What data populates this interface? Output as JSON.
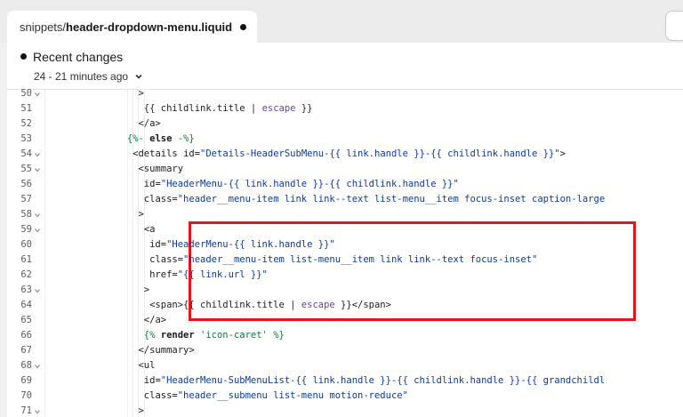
{
  "tab": {
    "directory": "snippets/",
    "filename": "header-dropdown-menu.liquid",
    "unsaved_indicator_icon": "dot-icon"
  },
  "changes": {
    "title": "Recent changes",
    "range": "24 - 21 minutes ago",
    "dropdown_icon": "chevron-down-icon"
  },
  "code_lines": [
    {
      "n": "50",
      "fold": true,
      "indent": 14,
      "html": ">"
    },
    {
      "n": "51",
      "fold": false,
      "indent": 15,
      "html": "{{ childlink.title | <span class='t-flt'>escape</span> }}"
    },
    {
      "n": "52",
      "fold": false,
      "indent": 14,
      "html": "&lt;/a&gt;"
    },
    {
      "n": "53",
      "fold": false,
      "indent": 12,
      "html": "<span class='t-lq'>{%- </span><span class='t-kw'>else</span><span class='t-lq'> -%}</span>"
    },
    {
      "n": "54",
      "fold": true,
      "indent": 13,
      "html": "&lt;details <span class='t-attr'>id=</span><span class='t-str'>\"Details-HeaderSubMenu-{{ link.handle }}-{{ childlink.handle }}\"</span>&gt;"
    },
    {
      "n": "55",
      "fold": true,
      "indent": 14,
      "html": "&lt;summary"
    },
    {
      "n": "56",
      "fold": false,
      "indent": 15,
      "html": "<span class='t-attr'>id=</span><span class='t-str'>\"HeaderMenu-{{ link.handle }}-{{ childlink.handle }}\"</span>"
    },
    {
      "n": "57",
      "fold": false,
      "indent": 15,
      "html": "<span class='t-attr'>class=</span><span class='t-str'>\"header__menu-item link link--text list-menu__item focus-inset caption-large</span>"
    },
    {
      "n": "58",
      "fold": true,
      "indent": 14,
      "html": "&gt;"
    },
    {
      "n": "59",
      "fold": true,
      "indent": 15,
      "html": "&lt;a"
    },
    {
      "n": "60",
      "fold": false,
      "indent": 16,
      "html": "<span class='t-attr'>id=</span><span class='t-str'>\"HeaderMenu-{{ link.handle }}\"</span>"
    },
    {
      "n": "61",
      "fold": false,
      "indent": 16,
      "html": "<span class='t-attr'>class=</span><span class='t-str'>\"header__menu-item list-menu__item link link--text focus-inset\"</span>"
    },
    {
      "n": "62",
      "fold": false,
      "indent": 16,
      "html": "<span class='t-attr'>href=</span><span class='t-str'>\"{{ link.url }}\"</span>"
    },
    {
      "n": "63",
      "fold": true,
      "indent": 15,
      "html": "&gt;"
    },
    {
      "n": "64",
      "fold": false,
      "indent": 16,
      "html": "&lt;span&gt;{{ childlink.title | <span class='t-flt'>escape</span> }}&lt;/span&gt;"
    },
    {
      "n": "65",
      "fold": false,
      "indent": 15,
      "html": "&lt;/a&gt;"
    },
    {
      "n": "66",
      "fold": false,
      "indent": 15,
      "html": "<span class='t-lq'>{% </span><span class='t-kw'>render</span><span class='t-lq'> 'icon-caret' %}</span>"
    },
    {
      "n": "67",
      "fold": false,
      "indent": 14,
      "html": "&lt;/summary&gt;"
    },
    {
      "n": "68",
      "fold": true,
      "indent": 14,
      "html": "&lt;ul"
    },
    {
      "n": "69",
      "fold": false,
      "indent": 15,
      "html": "<span class='t-attr'>id=</span><span class='t-str'>\"HeaderMenu-SubMenuList-{{ link.handle }}-{{ childlink.handle }}-{{ grandchildl</span>"
    },
    {
      "n": "70",
      "fold": false,
      "indent": 15,
      "html": "<span class='t-attr'>class=</span><span class='t-str'>\"header__submenu list-menu motion-reduce\"</span>"
    },
    {
      "n": "71",
      "fold": true,
      "indent": 14,
      "html": "&gt;"
    }
  ],
  "colors": {
    "highlight_border": "#e8141b",
    "string": "#0b3a9e",
    "filter": "#6b3fa0",
    "liquid_tag": "#0a7a3a"
  }
}
